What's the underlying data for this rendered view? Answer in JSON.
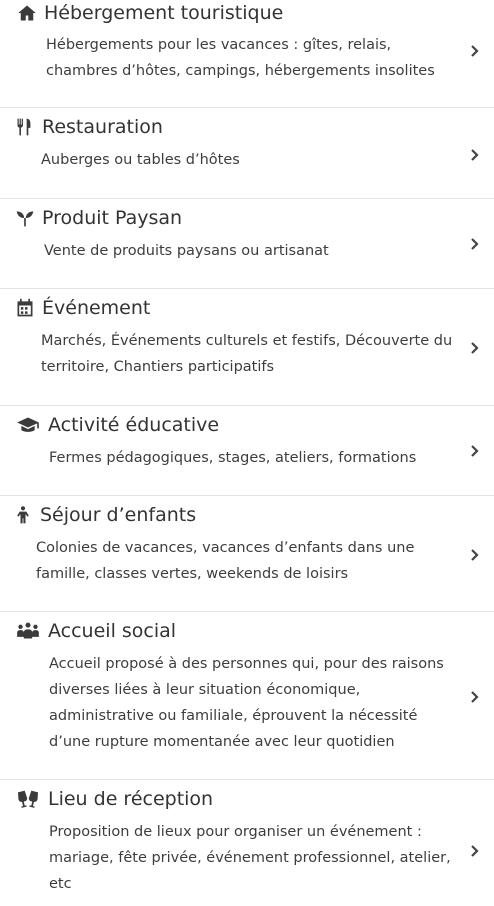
{
  "items": [
    {
      "title": "Hébergement touristique",
      "desc": "Hébergements pour les vacances : gîtes, relais, chambres d’hôtes, campings, hébergements insolites",
      "icon": "home-icon"
    },
    {
      "title": "Restauration",
      "desc": "Auberges ou tables d’hôtes",
      "icon": "utensils-icon"
    },
    {
      "title": "Produit Paysan",
      "desc": "Vente de produits paysans ou artisanat",
      "icon": "seedling-icon"
    },
    {
      "title": "Événement",
      "desc": "Marchés, Événements culturels et festifs, Découverte du territoire, Chantiers participatifs",
      "icon": "calendar-icon"
    },
    {
      "title": "Activité éducative",
      "desc": "Fermes pédagogiques, stages, ateliers, formations",
      "icon": "graduation-cap-icon"
    },
    {
      "title": "Séjour d’enfants",
      "desc": "Colonies de vacances, vacances d’enfants dans une famille, classes vertes, weekends de loisirs",
      "icon": "child-icon"
    },
    {
      "title": "Accueil social",
      "desc": "Accueil proposé à des personnes qui, pour des raisons diverses liées à leur situation économique, administrative ou familiale, éprouvent la nécessité d’une rupture momentanée avec leur quotidien",
      "icon": "users-icon"
    },
    {
      "title": "Lieu de réception",
      "desc": "Proposition de lieux pour organiser un événement : mariage, fête privée, événement professionnel, atelier, etc",
      "icon": "glasses-cheers-icon"
    }
  ]
}
